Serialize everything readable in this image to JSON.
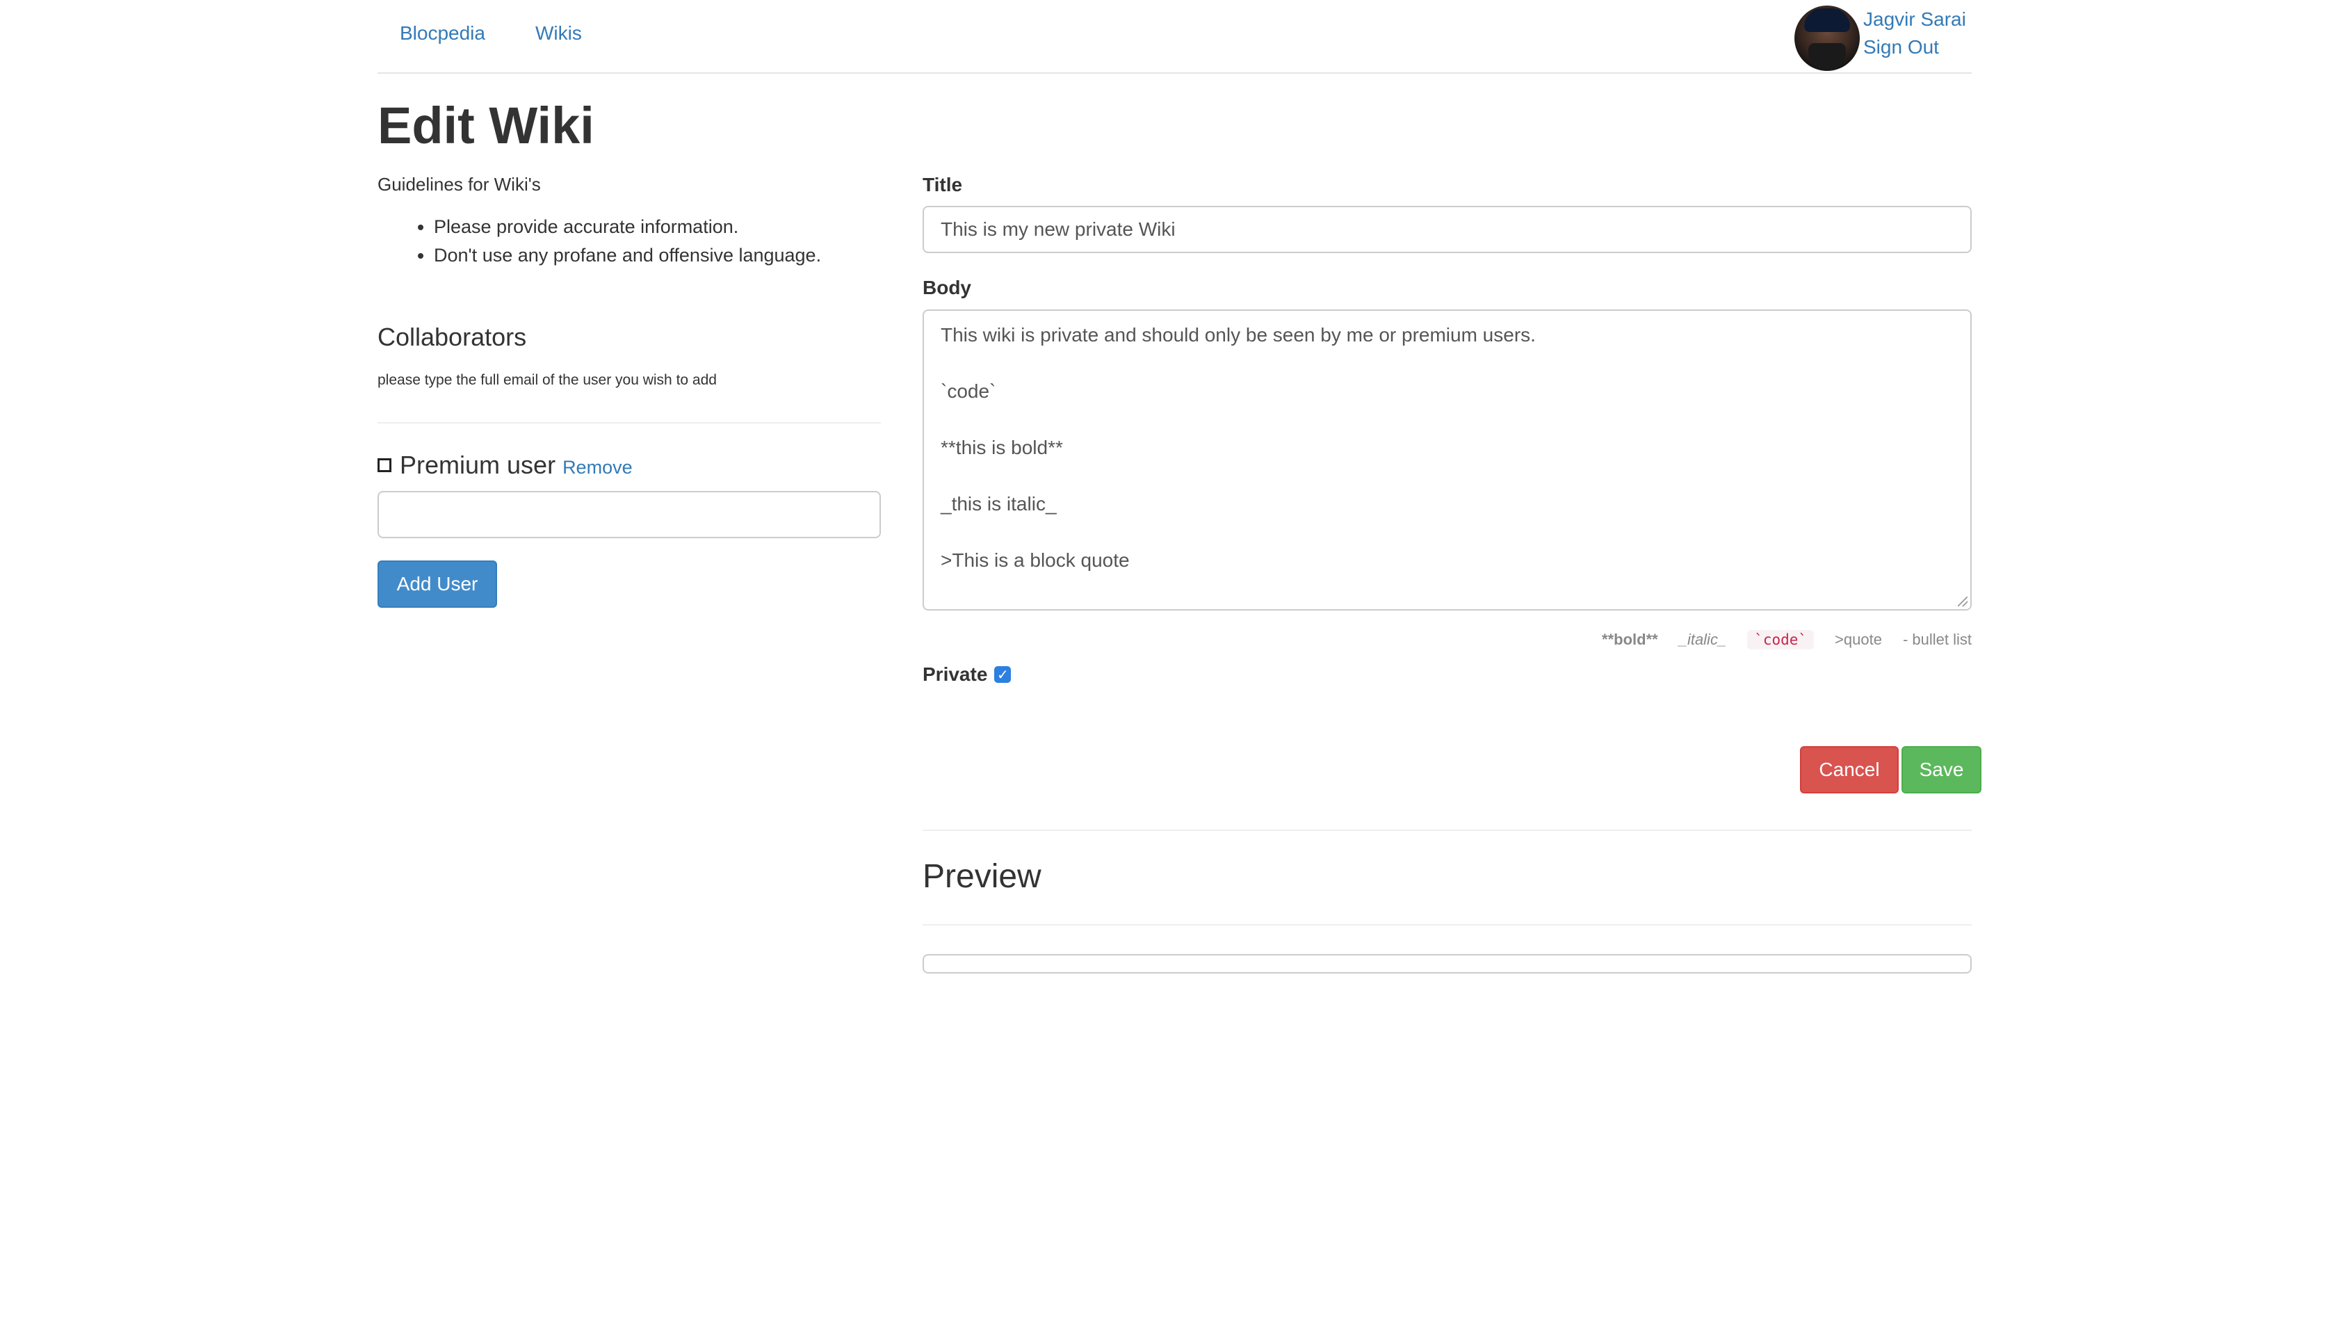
{
  "nav": {
    "brand": "Blocpedia",
    "wikis": "Wikis",
    "user_name": "Jagvir Sarai",
    "sign_out": "Sign Out"
  },
  "page": {
    "title": "Edit Wiki"
  },
  "guidelines": {
    "title": "Guidelines for Wiki's",
    "items": [
      "Please provide accurate information.",
      "Don't use any profane and offensive language."
    ]
  },
  "collaborators": {
    "title": "Collaborators",
    "help": "please type the full email of the user you wish to add",
    "entries": [
      {
        "name": "Premium user",
        "remove_label": "Remove"
      }
    ],
    "input_value": "",
    "add_button": "Add User"
  },
  "form": {
    "title_label": "Title",
    "title_value": "This is my new private Wiki",
    "body_label": "Body",
    "body_lines": [
      "This wiki is private and should only be seen by me or premium users.",
      "`code`",
      "**this is bold**",
      "_this is italic_",
      ">This is a block quote"
    ],
    "hints": {
      "bold": "**bold**",
      "italic": "_italic_",
      "code": "`code`",
      "quote": ">quote",
      "bullet": "- bullet list"
    },
    "private_label": "Private",
    "private_checked": true,
    "cancel_button": "Cancel",
    "save_button": "Save"
  },
  "preview": {
    "title": "Preview"
  },
  "colors": {
    "link": "#337ab7",
    "primary": "#428bca",
    "danger": "#d9534f",
    "success": "#5cb85c",
    "checkbox": "#2d80e0"
  }
}
